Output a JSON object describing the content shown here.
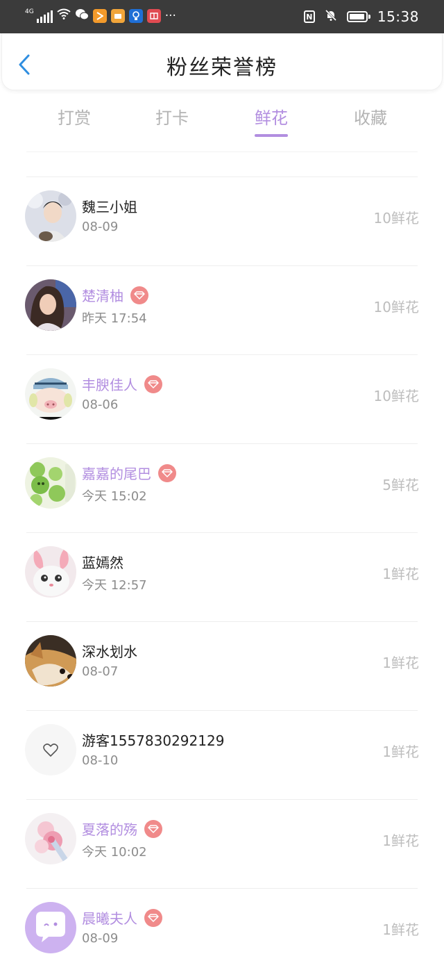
{
  "status_bar": {
    "network": "4G",
    "time": "15:38",
    "nfc": "N"
  },
  "header": {
    "title": "粉丝荣誉榜"
  },
  "tabs": [
    {
      "label": "打赏",
      "active": false
    },
    {
      "label": "打卡",
      "active": false
    },
    {
      "label": "鲜花",
      "active": true
    },
    {
      "label": "收藏",
      "active": false
    }
  ],
  "colors": {
    "accent": "#b28ee0",
    "vip_badge": "#f08a8a",
    "status_bar": "#3b3b3b"
  },
  "fans": [
    {
      "name": "魏三小姐",
      "date": "08-09",
      "amount": "10鲜花",
      "vip": false,
      "avatar": "avatar-photo-man"
    },
    {
      "name": "楚清柚",
      "date": "昨天 17:54",
      "amount": "10鲜花",
      "vip": true,
      "avatar": "avatar-photo-girl"
    },
    {
      "name": "丰腴佳人",
      "date": "08-06",
      "amount": "10鲜花",
      "vip": true,
      "avatar": "avatar-cartoon-pig"
    },
    {
      "name": "嘉嘉的尾巴",
      "date": "今天 15:02",
      "amount": "5鲜花",
      "vip": true,
      "avatar": "avatar-green-frogs"
    },
    {
      "name": "蓝嫣然",
      "date": "今天 12:57",
      "amount": "1鲜花",
      "vip": false,
      "avatar": "avatar-bunny"
    },
    {
      "name": "深水划水",
      "date": "08-07",
      "amount": "1鲜花",
      "vip": false,
      "avatar": "avatar-dog"
    },
    {
      "name": "游客1557830292129",
      "date": "08-10",
      "amount": "1鲜花",
      "vip": false,
      "avatar": "avatar-heart-default"
    },
    {
      "name": "夏落的殇",
      "date": "今天 10:02",
      "amount": "1鲜花",
      "vip": true,
      "avatar": "avatar-pink-floral"
    },
    {
      "name": "晨曦夫人",
      "date": "08-09",
      "amount": "1鲜花",
      "vip": true,
      "avatar": "avatar-purple-chat"
    }
  ]
}
